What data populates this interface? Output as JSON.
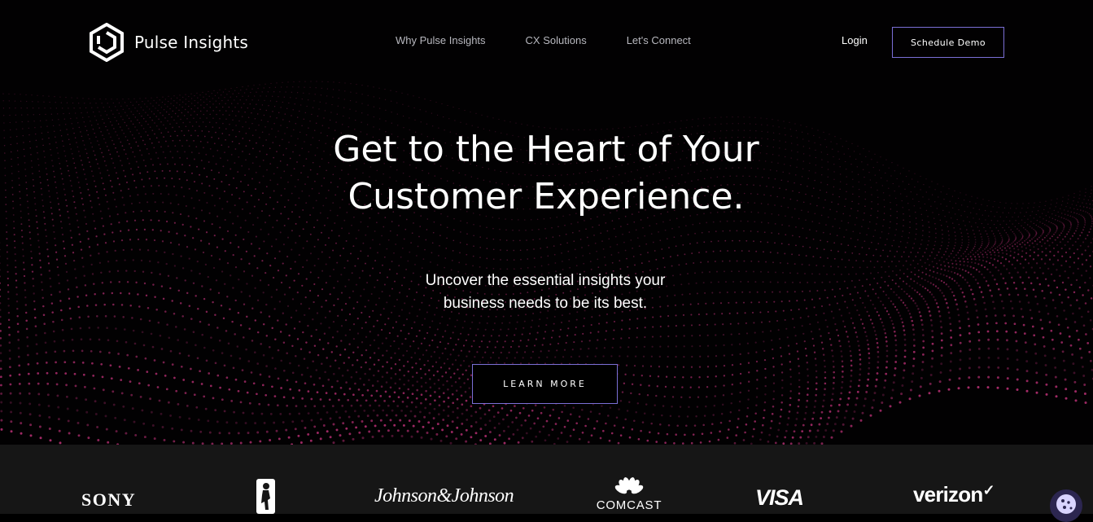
{
  "brand": {
    "name": "Pulse Insights",
    "logo_icon": "hexagon-logo-icon"
  },
  "nav": {
    "links": [
      "Why Pulse Insights",
      "CX Solutions",
      "Let's Connect"
    ],
    "login_label": "Login",
    "demo_label": "Schedule Demo"
  },
  "hero": {
    "headline_line1": "Get to the Heart of Your",
    "headline_line2": "Customer Experience.",
    "subhead_line1": "Uncover the essential insights your",
    "subhead_line2": "business needs to be its best.",
    "cta_label": "LEARN MORE"
  },
  "client_logos": [
    "SONY",
    "NBA",
    "Johnson & Johnson",
    "COMCAST",
    "VISA",
    "verizon"
  ],
  "client_logo_text": {
    "sony": "SONY",
    "jj": "Johnson&Johnson",
    "comcast": "COMCAST",
    "visa": "VISA",
    "verizon": "verizon",
    "verizon_check": "✓"
  },
  "cookie_widget": {
    "icon": "cookie-icon"
  },
  "colors": {
    "background": "#000000",
    "accent_border": "#7b6fd6",
    "wave_dots": "#c2327a",
    "logos_bar": "#161616",
    "nav_text": "#b8b8bf"
  }
}
